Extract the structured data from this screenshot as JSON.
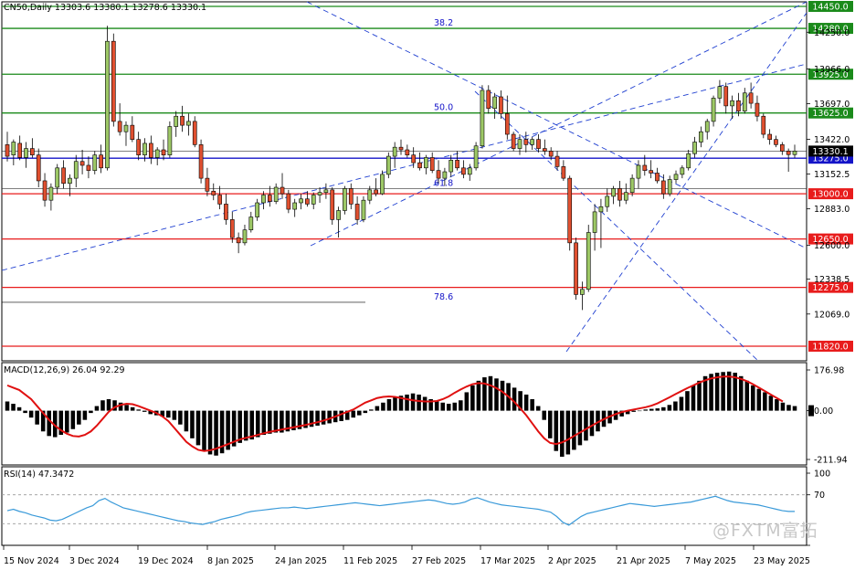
{
  "header": {
    "main_title": "CN50,Daily  13303.6  13380.1  13278.6  13330.1",
    "macd_title": "MACD(12,26,9) 26.04 92.29",
    "rsi_title": "RSI(14) 47.3472"
  },
  "watermark": "@FXTM富拓",
  "colors": {
    "bull": "#9dc866",
    "bear": "#e05030",
    "level_green": "#1a8a1a",
    "level_red": "#e81c1c",
    "level_blue": "#1414c8",
    "trend": "#1f3fd0",
    "macd_signal": "#e01010",
    "rsi_line": "#3a9ad9"
  },
  "chart_data": [
    {
      "type": "candlestick",
      "title": "CN50,Daily",
      "ylim": [
        11820,
        14450
      ],
      "price_ticks": [
        "14280.0",
        "14250.0",
        "13966.0",
        "13697.0",
        "13422.0",
        "13152.5",
        "12883.0",
        "12600.0",
        "12338.5",
        "12069.0"
      ],
      "x_tick_labels": [
        "15 Nov 2024",
        "3 Dec 2024",
        "19 Dec 2024",
        "8 Jan 2025",
        "24 Jan 2025",
        "11 Feb 2025",
        "27 Feb 2025",
        "17 Mar 2025",
        "2 Apr 2025",
        "21 Apr 2025",
        "7 May 2025",
        "23 May 2025"
      ],
      "current_price": "13330.1",
      "levels": [
        {
          "price": 14450,
          "label": "14450.0",
          "color": "green"
        },
        {
          "price": 14280,
          "label": "14280.0",
          "color": "green"
        },
        {
          "price": 13925,
          "label": "13925.0",
          "color": "green"
        },
        {
          "price": 13625,
          "label": "13625.0",
          "color": "green"
        },
        {
          "price": 13275,
          "label": "13275.0",
          "color": "blue"
        },
        {
          "price": 13000,
          "label": "13000.0",
          "color": "red"
        },
        {
          "price": 12650,
          "label": "12650.0",
          "color": "red"
        },
        {
          "price": 12275,
          "label": "12275.0",
          "color": "red"
        },
        {
          "price": 11820,
          "label": "11820.0",
          "color": "red"
        }
      ],
      "fib_labels": [
        {
          "label": "38.2",
          "price": 14280
        },
        {
          "label": "50.0",
          "price": 13625
        },
        {
          "label": "61.8",
          "price": 13040
        },
        {
          "label": "78.6",
          "price": 12160
        }
      ],
      "ohlc": [
        [
          13380,
          13480,
          13250,
          13290
        ],
        [
          13300,
          13420,
          13220,
          13400
        ],
        [
          13390,
          13450,
          13260,
          13280
        ],
        [
          13280,
          13400,
          13200,
          13350
        ],
        [
          13350,
          13430,
          13280,
          13300
        ],
        [
          13300,
          13350,
          13050,
          13100
        ],
        [
          13100,
          13160,
          12900,
          12950
        ],
        [
          12950,
          13080,
          12870,
          13050
        ],
        [
          13050,
          13230,
          13000,
          13200
        ],
        [
          13200,
          13260,
          13040,
          13080
        ],
        [
          13080,
          13150,
          12980,
          13120
        ],
        [
          13120,
          13300,
          13050,
          13250
        ],
        [
          13250,
          13340,
          13150,
          13220
        ],
        [
          13220,
          13290,
          13120,
          13180
        ],
        [
          13180,
          13330,
          13150,
          13300
        ],
        [
          13300,
          13380,
          13160,
          13200
        ],
        [
          13200,
          14300,
          13180,
          14180
        ],
        [
          14180,
          14240,
          13520,
          13560
        ],
        [
          13560,
          13700,
          13450,
          13480
        ],
        [
          13480,
          13560,
          13370,
          13530
        ],
        [
          13530,
          13600,
          13400,
          13420
        ],
        [
          13420,
          13480,
          13260,
          13300
        ],
        [
          13300,
          13430,
          13250,
          13390
        ],
        [
          13390,
          13450,
          13230,
          13280
        ],
        [
          13280,
          13360,
          13220,
          13340
        ],
        [
          13340,
          13420,
          13260,
          13300
        ],
        [
          13300,
          13560,
          13280,
          13520
        ],
        [
          13520,
          13640,
          13440,
          13600
        ],
        [
          13600,
          13680,
          13480,
          13530
        ],
        [
          13530,
          13620,
          13450,
          13560
        ],
        [
          13560,
          13600,
          13360,
          13380
        ],
        [
          13380,
          13420,
          13080,
          13120
        ],
        [
          13120,
          13200,
          12980,
          13020
        ],
        [
          13020,
          13080,
          12950,
          12990
        ],
        [
          12990,
          13060,
          12880,
          12920
        ],
        [
          12920,
          13000,
          12760,
          12800
        ],
        [
          12800,
          12860,
          12620,
          12660
        ],
        [
          12660,
          12700,
          12540,
          12620
        ],
        [
          12620,
          12760,
          12600,
          12720
        ],
        [
          12720,
          12860,
          12700,
          12820
        ],
        [
          12820,
          12960,
          12790,
          12930
        ],
        [
          12930,
          13020,
          12880,
          12990
        ],
        [
          12990,
          13060,
          12900,
          12940
        ],
        [
          12940,
          13080,
          12920,
          13050
        ],
        [
          13050,
          13160,
          12960,
          13000
        ],
        [
          13000,
          13030,
          12850,
          12880
        ],
        [
          12880,
          12960,
          12820,
          12930
        ],
        [
          12930,
          13000,
          12880,
          12960
        ],
        [
          12960,
          13020,
          12900,
          12920
        ],
        [
          12920,
          13010,
          12880,
          12990
        ],
        [
          12990,
          13050,
          12930,
          13010
        ],
        [
          13010,
          13080,
          12960,
          13030
        ],
        [
          13030,
          13050,
          12760,
          12800
        ],
        [
          12800,
          12900,
          12660,
          12870
        ],
        [
          12870,
          13060,
          12840,
          13040
        ],
        [
          13040,
          13080,
          12880,
          12920
        ],
        [
          12920,
          12980,
          12760,
          12800
        ],
        [
          12800,
          12980,
          12780,
          12950
        ],
        [
          12950,
          13060,
          12920,
          13030
        ],
        [
          13030,
          13120,
          12980,
          13000
        ],
        [
          13000,
          13180,
          12990,
          13150
        ],
        [
          13150,
          13320,
          13120,
          13290
        ],
        [
          13290,
          13400,
          13200,
          13360
        ],
        [
          13360,
          13420,
          13300,
          13340
        ],
        [
          13340,
          13380,
          13280,
          13300
        ],
        [
          13300,
          13360,
          13200,
          13240
        ],
        [
          13240,
          13320,
          13180,
          13200
        ],
        [
          13200,
          13300,
          13150,
          13280
        ],
        [
          13280,
          13320,
          13160,
          13180
        ],
        [
          13180,
          13260,
          13080,
          13120
        ],
        [
          13120,
          13200,
          13060,
          13170
        ],
        [
          13170,
          13300,
          13130,
          13260
        ],
        [
          13260,
          13330,
          13180,
          13200
        ],
        [
          13200,
          13260,
          13120,
          13150
        ],
        [
          13150,
          13230,
          13100,
          13200
        ],
        [
          13200,
          13400,
          13180,
          13370
        ],
        [
          13370,
          13840,
          13350,
          13800
        ],
        [
          13800,
          13840,
          13620,
          13660
        ],
        [
          13660,
          13780,
          13580,
          13750
        ],
        [
          13750,
          13800,
          13580,
          13620
        ],
        [
          13620,
          13760,
          13420,
          13460
        ],
        [
          13460,
          13480,
          13330,
          13350
        ],
        [
          13350,
          13460,
          13300,
          13420
        ],
        [
          13420,
          13480,
          13320,
          13380
        ],
        [
          13380,
          13440,
          13340,
          13420
        ],
        [
          13420,
          13460,
          13320,
          13350
        ],
        [
          13350,
          13420,
          13300,
          13330
        ],
        [
          13330,
          13360,
          13260,
          13290
        ],
        [
          13290,
          13330,
          13180,
          13210
        ],
        [
          13210,
          13260,
          13100,
          13120
        ],
        [
          13120,
          13140,
          12560,
          12620
        ],
        [
          12620,
          12660,
          12180,
          12220
        ],
        [
          12220,
          12320,
          12100,
          12260
        ],
        [
          12260,
          12760,
          12240,
          12700
        ],
        [
          12700,
          12920,
          12560,
          12860
        ],
        [
          12860,
          12960,
          12580,
          12900
        ],
        [
          12900,
          13040,
          12860,
          12980
        ],
        [
          12980,
          13060,
          12920,
          13040
        ],
        [
          13040,
          13100,
          12900,
          12950
        ],
        [
          12950,
          13080,
          12920,
          13010
        ],
        [
          13010,
          13150,
          12980,
          13120
        ],
        [
          13120,
          13260,
          13040,
          13220
        ],
        [
          13220,
          13300,
          13140,
          13180
        ],
        [
          13180,
          13260,
          13120,
          13160
        ],
        [
          13160,
          13200,
          13080,
          13100
        ],
        [
          13100,
          13150,
          12960,
          13000
        ],
        [
          13000,
          13140,
          12980,
          13110
        ],
        [
          13110,
          13180,
          13080,
          13150
        ],
        [
          13150,
          13220,
          13120,
          13200
        ],
        [
          13200,
          13340,
          13180,
          13310
        ],
        [
          13310,
          13440,
          13280,
          13400
        ],
        [
          13400,
          13520,
          13360,
          13480
        ],
        [
          13480,
          13580,
          13420,
          13560
        ],
        [
          13560,
          13760,
          13520,
          13740
        ],
        [
          13740,
          13880,
          13700,
          13830
        ],
        [
          13830,
          13860,
          13620,
          13680
        ],
        [
          13680,
          13760,
          13580,
          13720
        ],
        [
          13720,
          13780,
          13600,
          13640
        ],
        [
          13640,
          13820,
          13620,
          13780
        ],
        [
          13780,
          13860,
          13660,
          13700
        ],
        [
          13700,
          13760,
          13560,
          13600
        ],
        [
          13600,
          13620,
          13430,
          13460
        ],
        [
          13460,
          13500,
          13380,
          13420
        ],
        [
          13420,
          13450,
          13360,
          13380
        ],
        [
          13380,
          13400,
          13300,
          13330
        ],
        [
          13330,
          13350,
          13170,
          13303
        ],
        [
          13303,
          13380,
          13278,
          13330
        ]
      ],
      "macd": {
        "title": "MACD(12,26,9)",
        "ylim": [
          -211.94,
          176.98
        ],
        "ticks": [
          "176.98",
          "0.00",
          "-211.94"
        ],
        "histogram": [
          40,
          30,
          15,
          -10,
          -30,
          -60,
          -90,
          -110,
          -115,
          -105,
          -95,
          -80,
          -60,
          -40,
          -10,
          20,
          45,
          50,
          45,
          35,
          25,
          15,
          5,
          -5,
          -15,
          -20,
          -25,
          -30,
          -40,
          -60,
          -90,
          -120,
          -150,
          -175,
          -190,
          -195,
          -185,
          -170,
          -155,
          -140,
          -130,
          -125,
          -115,
          -105,
          -100,
          -95,
          -95,
          -90,
          -85,
          -80,
          -75,
          -70,
          -65,
          -60,
          -55,
          -50,
          -45,
          -40,
          -30,
          -20,
          -10,
          5,
          20,
          35,
          50,
          60,
          65,
          70,
          75,
          70,
          60,
          50,
          40,
          35,
          30,
          35,
          45,
          80,
          110,
          130,
          145,
          150,
          140,
          130,
          120,
          100,
          85,
          70,
          50,
          20,
          -40,
          -120,
          -175,
          -200,
          -190,
          -170,
          -150,
          -130,
          -110,
          -90,
          -70,
          -55,
          -40,
          -25,
          -15,
          -5,
          0,
          5,
          8,
          10,
          15,
          25,
          40,
          60,
          85,
          110,
          130,
          150,
          160,
          165,
          168,
          170,
          165,
          150,
          130,
          110,
          95,
          80,
          65,
          50,
          35,
          25,
          20
        ],
        "signal": [
          110,
          100,
          90,
          70,
          50,
          20,
          -10,
          -40,
          -65,
          -85,
          -100,
          -110,
          -112,
          -105,
          -90,
          -65,
          -35,
          -5,
          15,
          25,
          30,
          28,
          20,
          10,
          0,
          -10,
          -25,
          -45,
          -75,
          -105,
          -135,
          -155,
          -170,
          -175,
          -172,
          -165,
          -155,
          -145,
          -135,
          -125,
          -118,
          -112,
          -105,
          -98,
          -92,
          -87,
          -82,
          -77,
          -72,
          -67,
          -62,
          -56,
          -50,
          -43,
          -35,
          -25,
          -15,
          -5,
          5,
          20,
          35,
          45,
          55,
          60,
          62,
          60,
          55,
          50,
          45,
          42,
          40,
          40,
          42,
          50,
          62,
          78,
          92,
          105,
          115,
          120,
          118,
          110,
          98,
          82,
          62,
          38,
          10,
          -20,
          -55,
          -90,
          -120,
          -140,
          -145,
          -138,
          -125,
          -110,
          -95,
          -80,
          -65,
          -50,
          -37,
          -25,
          -15,
          -6,
          0,
          5,
          10,
          15,
          22,
          32,
          45,
          58,
          72,
          85,
          98,
          110,
          122,
          132,
          140,
          145,
          148,
          148,
          145,
          138,
          128,
          115,
          100,
          85,
          70,
          55,
          40
        ],
        "hist_color": "#000000"
      },
      "rsi": {
        "title": "RSI(14)",
        "ylim": [
          0,
          100
        ],
        "ticks": [
          "100",
          "70",
          "30",
          "0"
        ],
        "values": [
          48,
          50,
          47,
          45,
          42,
          40,
          38,
          35,
          34,
          36,
          40,
          44,
          48,
          52,
          55,
          62,
          65,
          60,
          56,
          52,
          50,
          48,
          46,
          44,
          42,
          40,
          38,
          36,
          34,
          33,
          31,
          30,
          29,
          31,
          33,
          36,
          38,
          40,
          42,
          45,
          47,
          48,
          49,
          50,
          51,
          52,
          52,
          53,
          52,
          51,
          52,
          53,
          54,
          55,
          56,
          57,
          58,
          59,
          58,
          57,
          56,
          55,
          56,
          57,
          58,
          59,
          60,
          61,
          62,
          63,
          62,
          60,
          58,
          57,
          58,
          60,
          64,
          66,
          63,
          60,
          58,
          56,
          55,
          54,
          53,
          52,
          51,
          50,
          48,
          46,
          40,
          32,
          28,
          34,
          40,
          44,
          46,
          48,
          50,
          52,
          54,
          56,
          58,
          57,
          56,
          55,
          54,
          55,
          56,
          57,
          58,
          59,
          60,
          62,
          64,
          66,
          68,
          65,
          62,
          60,
          59,
          58,
          57,
          56,
          54,
          52,
          50,
          48,
          47,
          47
        ],
        "levels": [
          70,
          30
        ],
        "line_color": "#3a9ad9"
      }
    }
  ]
}
